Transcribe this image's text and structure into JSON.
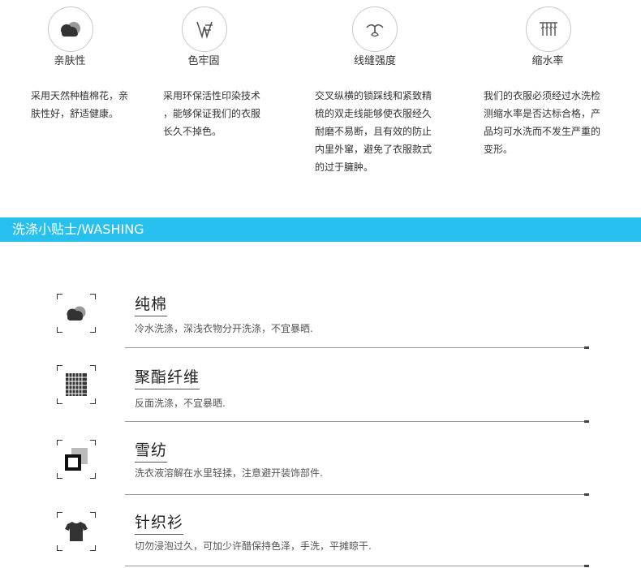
{
  "features": [
    {
      "icon": "cloud-icon",
      "title": "亲肤性",
      "desc": "采用天然种植棉花，亲\n肤性好，舒适健康。"
    },
    {
      "icon": "dye-icon",
      "title": "色牢固",
      "desc": "采用环保活性印染技术\n，能够保证我们的衣服\n长久不掉色。"
    },
    {
      "icon": "seam-icon",
      "title": "线缝强度",
      "desc": "交叉纵横的锁踩线和紧致精\n梳的双走线能够使衣服经久\n耐磨不易断，且有效的防止\n内里外窜，避免了衣服款式\n的过于臃肿。"
    },
    {
      "icon": "shrink-icon",
      "title": "缩水率",
      "desc": "我们的衣服必须经过水洗检\n测缩水率是否达标合格，产\n品均可水洗而不发生严重的\n变形。"
    }
  ],
  "washing": {
    "heading": "洗涤小贴士/WASHING",
    "items": [
      {
        "icon": "cloud-icon",
        "title": "纯棉",
        "desc": "冷水洗涤，深浅衣物分开洗涤，不宜暴晒."
      },
      {
        "icon": "grid-fabric-icon",
        "title": "聚酯纤维",
        "desc": "反面洗涤，不宜暴晒."
      },
      {
        "icon": "chiffon-layers-icon",
        "title": "雪纺",
        "desc": "洗衣液溶解在水里轻揉，注意避开装饰部件."
      },
      {
        "icon": "tshirt-icon",
        "title": "针织衫",
        "desc": "切勿浸泡过久，可加少许醋保持色泽，手洗，平摊晾干."
      }
    ]
  },
  "colors": {
    "banner": "#28c0ee",
    "text": "#333333",
    "icon_dark": "#333333",
    "icon_light": "#999999"
  }
}
